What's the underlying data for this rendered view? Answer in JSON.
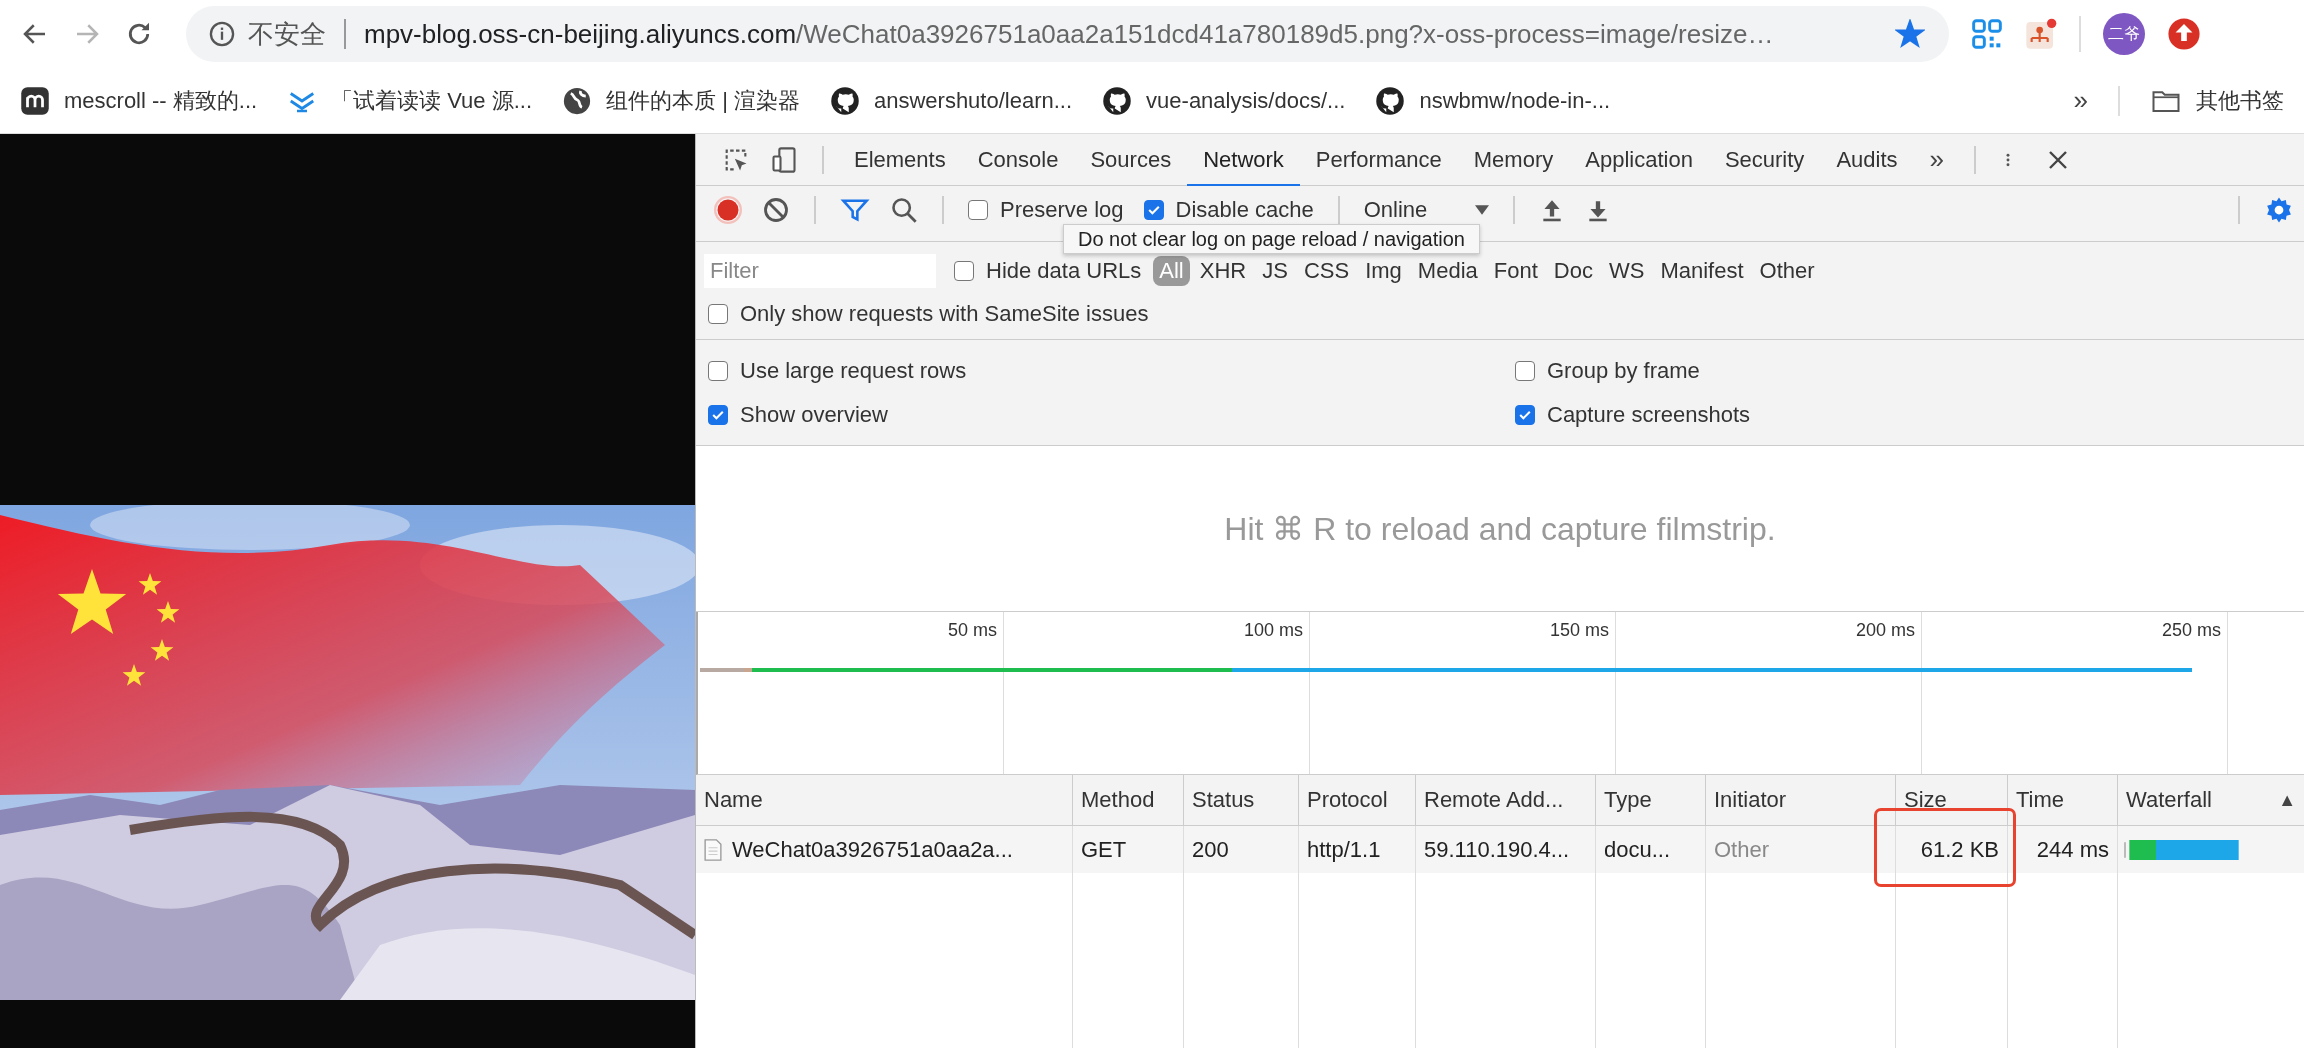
{
  "browser_toolbar": {
    "back_disabled": false,
    "forward_disabled": true
  },
  "address_bar": {
    "security_label": "不安全",
    "host": "mpv-blog.oss-cn-beijing.aliyuncs.com",
    "path": "/WeChat0a3926751a0aa2a151dcd41a780189d5.png?x-oss-process=image/resize…",
    "bookmarked": true
  },
  "profile": {
    "avatar_text": "二爷"
  },
  "bookmarks": {
    "items": [
      {
        "kind": "m",
        "label": "mescroll -- 精致的..."
      },
      {
        "kind": "chevrons",
        "label": "「试着读读 Vue 源..."
      },
      {
        "kind": "globe",
        "label": "组件的本质 | 渲染器"
      },
      {
        "kind": "github",
        "label": "answershuto/learn..."
      },
      {
        "kind": "github",
        "label": "vue-analysis/docs/..."
      },
      {
        "kind": "github",
        "label": "nswbmw/node-in-..."
      }
    ],
    "overflow": "»",
    "other_folder": "其他书签"
  },
  "devtools": {
    "tabs": [
      {
        "label": "Elements",
        "selected": false
      },
      {
        "label": "Console",
        "selected": false
      },
      {
        "label": "Sources",
        "selected": false
      },
      {
        "label": "Network",
        "selected": true
      },
      {
        "label": "Performance",
        "selected": false
      },
      {
        "label": "Memory",
        "selected": false
      },
      {
        "label": "Application",
        "selected": false
      },
      {
        "label": "Security",
        "selected": false
      },
      {
        "label": "Audits",
        "selected": false
      }
    ],
    "overflow": "»",
    "toolbar": {
      "recording": true,
      "filter_shown": true,
      "preserve_log": {
        "label": "Preserve log",
        "checked": false
      },
      "disable_cache": {
        "label": "Disable cache",
        "checked": true
      },
      "throttling": "Online"
    },
    "tooltip": "Do not clear log on page reload / navigation",
    "filter": {
      "placeholder": "Filter",
      "hide_data_urls": {
        "label": "Hide data URLs",
        "checked": false
      },
      "types": [
        {
          "label": "All",
          "selected": true
        },
        {
          "label": "XHR",
          "selected": false
        },
        {
          "label": "JS",
          "selected": false
        },
        {
          "label": "CSS",
          "selected": false
        },
        {
          "label": "Img",
          "selected": false
        },
        {
          "label": "Media",
          "selected": false
        },
        {
          "label": "Font",
          "selected": false
        },
        {
          "label": "Doc",
          "selected": false
        },
        {
          "label": "WS",
          "selected": false
        },
        {
          "label": "Manifest",
          "selected": false
        },
        {
          "label": "Other",
          "selected": false
        }
      ]
    },
    "samesite": {
      "label": "Only show requests with SameSite issues",
      "checked": false
    },
    "settings": [
      {
        "label": "Use large request rows",
        "checked": false
      },
      {
        "label": "Group by frame",
        "checked": false
      },
      {
        "label": "Show overview",
        "checked": true
      },
      {
        "label": "Capture screenshots",
        "checked": true
      }
    ],
    "filmstrip_message": "Hit ⌘ R to reload and capture filmstrip.",
    "overview_ticks": [
      "50 ms",
      "100 ms",
      "150 ms",
      "200 ms",
      "250 ms"
    ],
    "table": {
      "columns": [
        {
          "label": "Name"
        },
        {
          "label": "Method"
        },
        {
          "label": "Status"
        },
        {
          "label": "Protocol"
        },
        {
          "label": "Remote Add..."
        },
        {
          "label": "Type"
        },
        {
          "label": "Initiator"
        },
        {
          "label": "Size"
        },
        {
          "label": "Time"
        },
        {
          "label": "Waterfall",
          "sort": "▲"
        }
      ],
      "rows": [
        {
          "cells": [
            {
              "text": "WeChat0a3926751a0aa2a...",
              "muted": false,
              "highlighted": false
            },
            {
              "text": "GET",
              "muted": false,
              "highlighted": false
            },
            {
              "text": "200",
              "muted": false,
              "highlighted": false
            },
            {
              "text": "http/1.1",
              "muted": false,
              "highlighted": false
            },
            {
              "text": "59.110.190.4...",
              "muted": false,
              "highlighted": false
            },
            {
              "text": "docu...",
              "muted": false,
              "highlighted": false
            },
            {
              "text": "Other",
              "muted": true,
              "highlighted": false
            },
            {
              "text": "61.2 KB",
              "muted": false,
              "highlighted": true
            },
            {
              "text": "244 ms",
              "muted": false,
              "highlighted": false
            }
          ]
        }
      ]
    }
  }
}
